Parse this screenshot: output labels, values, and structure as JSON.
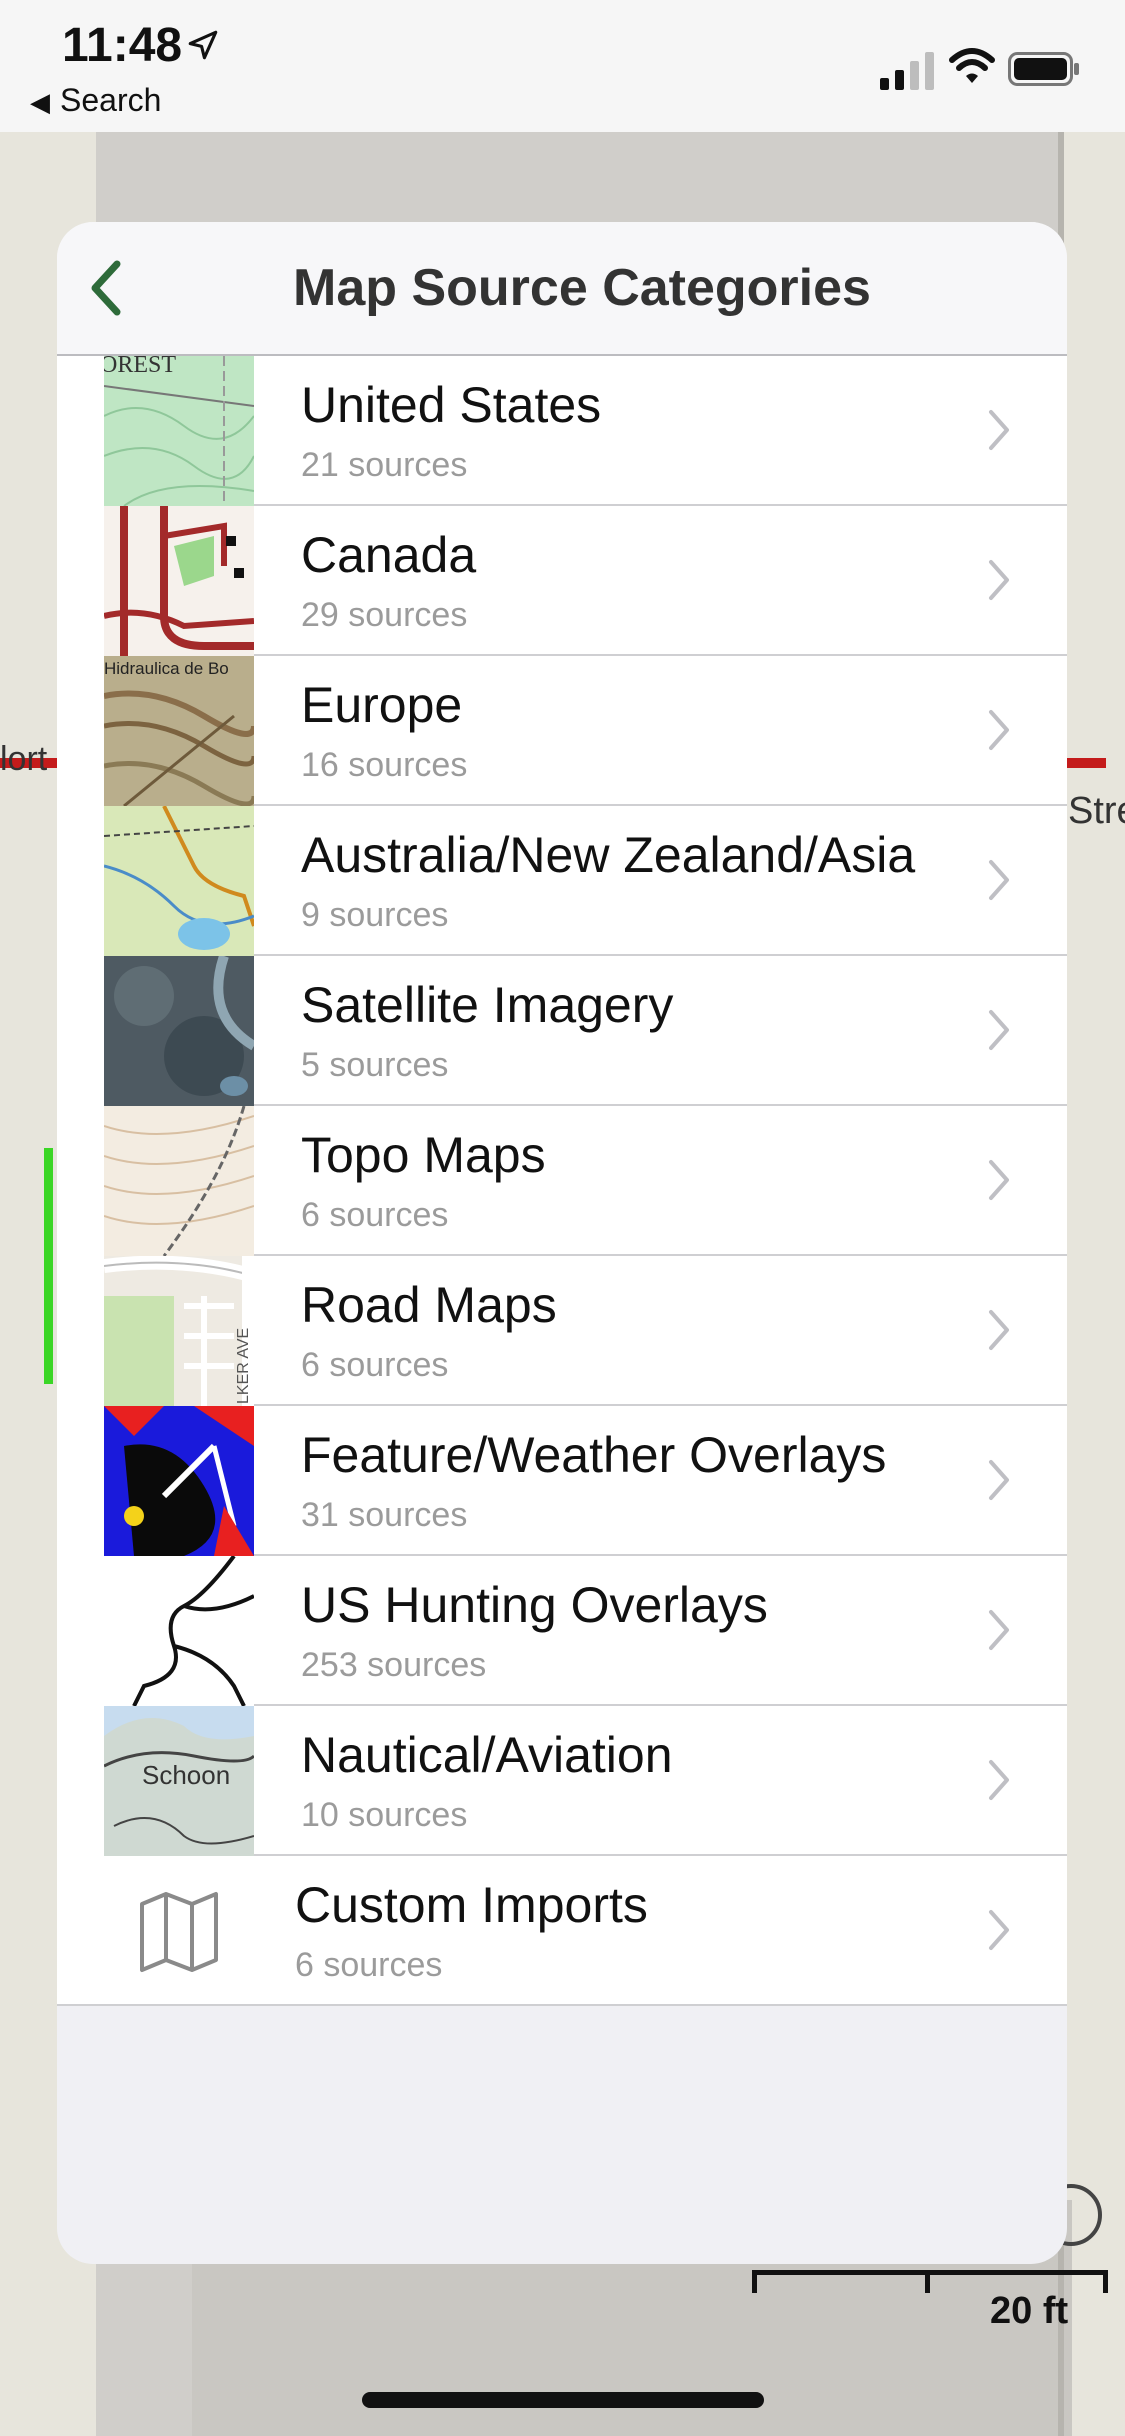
{
  "status_bar": {
    "time": "11:48",
    "back_label": "Search"
  },
  "sheet": {
    "title": "Map Source Categories"
  },
  "categories": [
    {
      "label": "United States",
      "count": "21 sources"
    },
    {
      "label": "Canada",
      "count": "29 sources"
    },
    {
      "label": "Europe",
      "count": "16 sources"
    },
    {
      "label": "Australia/New Zealand/Asia",
      "count": "9 sources"
    },
    {
      "label": "Satellite Imagery",
      "count": "5 sources"
    },
    {
      "label": "Topo Maps",
      "count": "6 sources"
    },
    {
      "label": "Road Maps",
      "count": "6 sources"
    },
    {
      "label": "Feature/Weather Overlays",
      "count": "31 sources"
    },
    {
      "label": "US Hunting Overlays",
      "count": "253 sources"
    },
    {
      "label": "Nautical/Aviation",
      "count": "10 sources"
    },
    {
      "label": "Custom Imports",
      "count": "6 sources"
    }
  ],
  "thumb_text": {
    "us": "OREST",
    "canada": "",
    "europe": "Hidraulica de Bo",
    "road": "LKER AVE",
    "nautical": "Schoon"
  },
  "map": {
    "scale_label": "20 ft",
    "street_left": "lort",
    "street_right": "Stre"
  },
  "colors": {
    "accent_green": "#2e6b3a",
    "chevron": "#bfbfc4",
    "subtitle": "#9b9b9b"
  }
}
